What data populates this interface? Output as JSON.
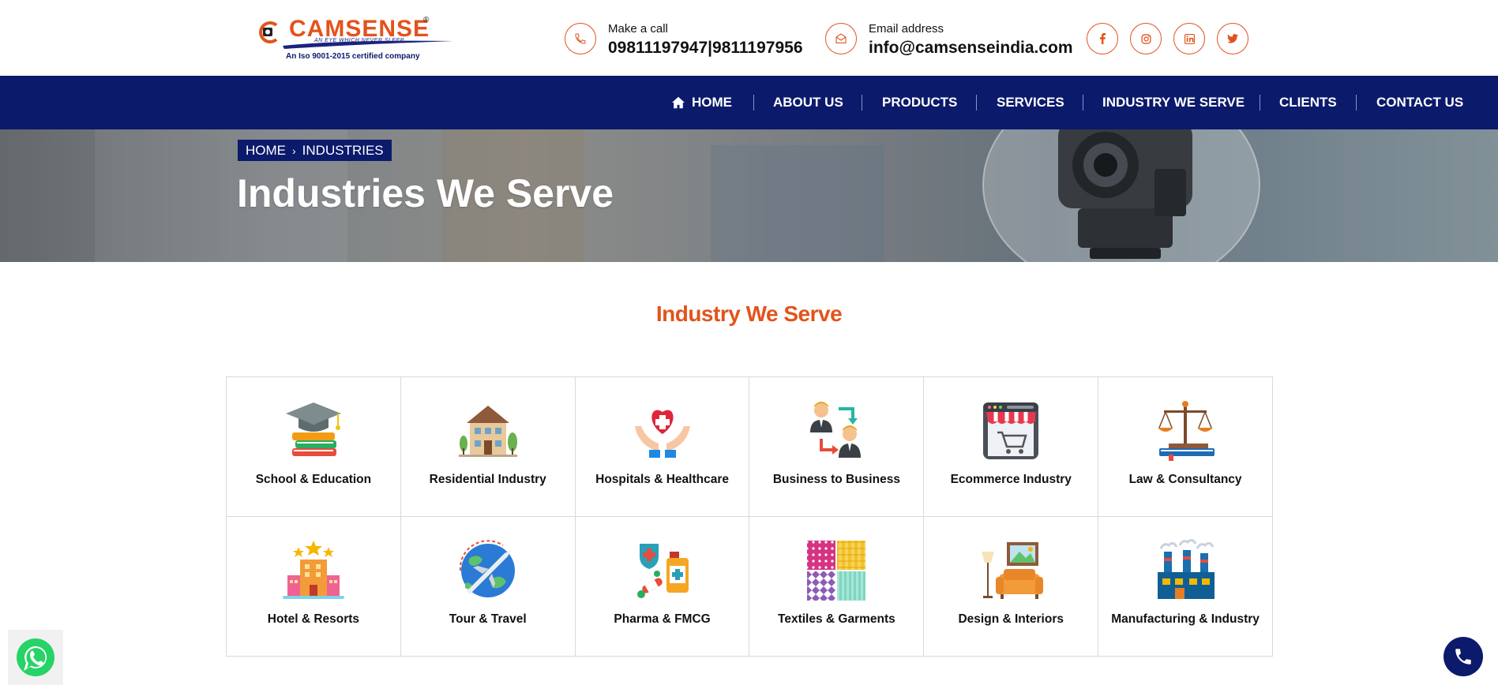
{
  "header": {
    "logo": {
      "brand": "CAMSENSE",
      "tagline": "AN EYE WHICH NEVER SLEEP...",
      "certification": "An Iso 9001-2015 certified company"
    },
    "call": {
      "label": "Make a call",
      "value": "09811197947|9811197956",
      "icon": "phone-icon"
    },
    "email": {
      "label": "Email address",
      "value": "info@camsenseindia.com",
      "icon": "envelope-icon"
    },
    "social": [
      "facebook-icon",
      "instagram-icon",
      "linkedin-icon",
      "twitter-icon"
    ],
    "accent_color": "#e2531c"
  },
  "nav": {
    "background": "#0b1a6b",
    "items": [
      {
        "label": "HOME",
        "icon": "home-icon"
      },
      {
        "label": "ABOUT US"
      },
      {
        "label": "PRODUCTS"
      },
      {
        "label": "SERVICES"
      },
      {
        "label": "INDUSTRY WE SERVE"
      },
      {
        "label": "CLIENTS"
      },
      {
        "label": "CONTACT US"
      }
    ]
  },
  "hero": {
    "breadcrumb": {
      "home": "HOME",
      "separator": "›",
      "current": "INDUSTRIES"
    },
    "title": "Industries We Serve"
  },
  "industries": {
    "title": "Industry We Serve",
    "items": [
      {
        "label": "School & Education",
        "icon": "graduation-cap-books-icon"
      },
      {
        "label": "Residential Industry",
        "icon": "house-icon"
      },
      {
        "label": "Hospitals & Healthcare",
        "icon": "heart-hands-icon"
      },
      {
        "label": "Business to Business",
        "icon": "business-people-exchange-icon"
      },
      {
        "label": "Ecommerce Industry",
        "icon": "online-shop-cart-icon"
      },
      {
        "label": "Law & Consultancy",
        "icon": "scales-of-justice-icon"
      },
      {
        "label": "Hotel & Resorts",
        "icon": "hotel-stars-icon"
      },
      {
        "label": "Tour & Travel",
        "icon": "globe-airplane-icon"
      },
      {
        "label": "Pharma & FMCG",
        "icon": "medicine-bottle-pills-icon"
      },
      {
        "label": "Textiles & Garments",
        "icon": "fabric-swatches-icon"
      },
      {
        "label": "Design & Interiors",
        "icon": "sofa-lamp-frame-icon"
      },
      {
        "label": "Manufacturing & Industry",
        "icon": "factory-icon"
      }
    ]
  },
  "floating": {
    "whatsapp": "whatsapp-icon",
    "call": "phone-icon"
  }
}
